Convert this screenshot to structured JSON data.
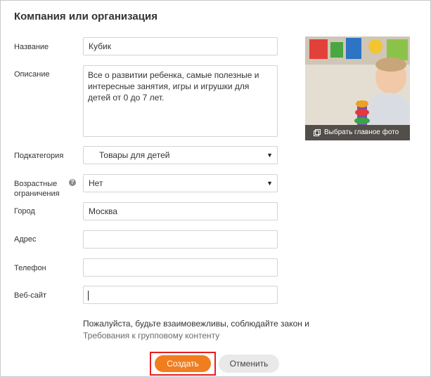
{
  "dialog": {
    "title": "Компания или организация"
  },
  "form": {
    "name": {
      "label": "Название",
      "value": "Кубик"
    },
    "description": {
      "label": "Описание",
      "value": "Все о развитии ребенка, самые полезные и интересные занятия, игры и игрушки для детей от 0 до 7 лет."
    },
    "subcategory": {
      "label": "Подкатегория",
      "value": "Товары для детей"
    },
    "age": {
      "label": "Возрастные ограничения",
      "value": "Нет"
    },
    "city": {
      "label": "Город",
      "value": "Москва"
    },
    "address": {
      "label": "Адрес",
      "value": ""
    },
    "phone": {
      "label": "Телефон",
      "value": ""
    },
    "website": {
      "label": "Веб-сайт",
      "value": ""
    }
  },
  "photo": {
    "button_label": "Выбрать главное фото"
  },
  "notice": {
    "text": "Пожалуйста, будьте взаимовежливы, соблюдайте закон и",
    "link": "Требования к групповому контенту"
  },
  "buttons": {
    "create": "Создать",
    "cancel": "Отменить"
  },
  "colors": {
    "accent": "#f07e1f",
    "highlight_border": "#e81d1d"
  }
}
